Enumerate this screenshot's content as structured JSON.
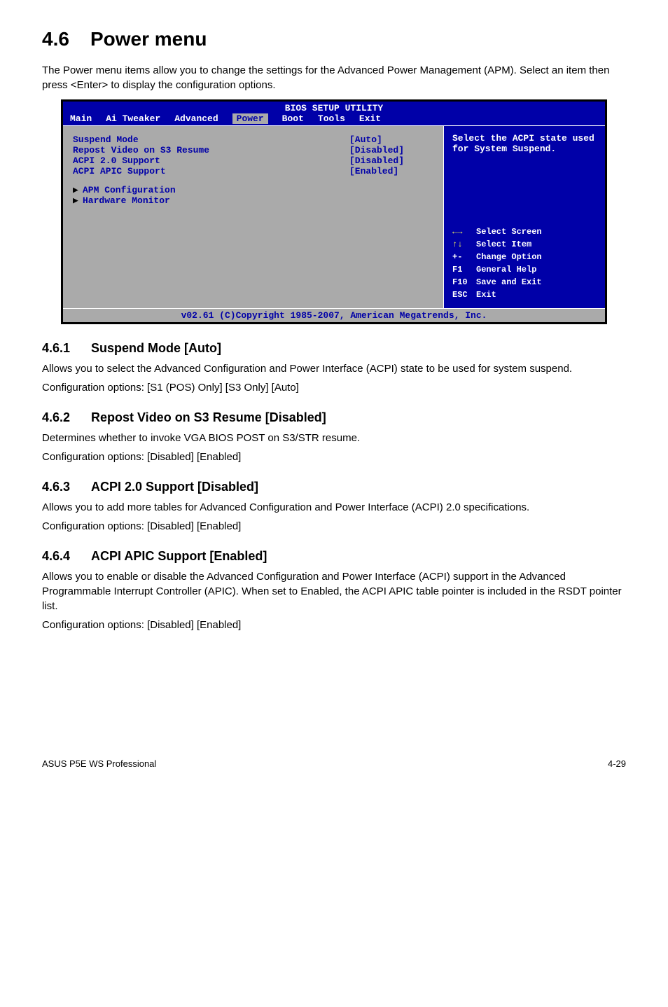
{
  "section": {
    "num": "4.6",
    "title": "Power menu"
  },
  "intro": "The Power menu items allow you to change the settings for the Advanced Power Management (APM). Select an item then press <Enter> to display the configuration options.",
  "bios": {
    "title": "BIOS SETUP UTILITY",
    "tabs": [
      "Main",
      "Ai Tweaker",
      "Advanced",
      "Power",
      "Boot",
      "Tools",
      "Exit"
    ],
    "activeTab": "Power",
    "rows": [
      {
        "label": "Suspend Mode",
        "value": "[Auto]"
      },
      {
        "label": "Repost Video on S3 Resume",
        "value": "[Disabled]"
      },
      {
        "label": "ACPI 2.0 Support",
        "value": "[Disabled]"
      },
      {
        "label": "ACPI APIC Support",
        "value": "[Enabled]"
      }
    ],
    "subs": [
      "APM Configuration",
      "Hardware Monitor"
    ],
    "helpTop": "Select the ACPI state used for System Suspend.",
    "helpKeys": [
      {
        "key": "←→",
        "desc": "Select Screen",
        "yel": true
      },
      {
        "key": "↑↓",
        "desc": "Select Item",
        "yel": true
      },
      {
        "key": "+-",
        "desc": "Change Option",
        "yel": false
      },
      {
        "key": "F1",
        "desc": "General Help",
        "yel": false
      },
      {
        "key": "F10",
        "desc": "Save and Exit",
        "yel": false
      },
      {
        "key": "ESC",
        "desc": "Exit",
        "yel": false
      }
    ],
    "footer": "v02.61 (C)Copyright 1985-2007, American Megatrends, Inc."
  },
  "subs": [
    {
      "num": "4.6.1",
      "title": "Suspend Mode [Auto]",
      "p1": "Allows you to select the Advanced Configuration and Power Interface (ACPI) state to be used for system suspend.",
      "p2": "Configuration options: [S1 (POS) Only] [S3 Only] [Auto]"
    },
    {
      "num": "4.6.2",
      "title": "Repost Video on S3 Resume [Disabled]",
      "p1": "Determines whether to invoke VGA BIOS POST on S3/STR resume.",
      "p2": "Configuration options: [Disabled] [Enabled]"
    },
    {
      "num": "4.6.3",
      "title": "ACPI 2.0 Support [Disabled]",
      "p1": "Allows you to add more tables for Advanced Configuration and Power Interface (ACPI) 2.0 specifications.",
      "p2": "Configuration options: [Disabled] [Enabled]"
    },
    {
      "num": "4.6.4",
      "title": "ACPI APIC Support [Enabled]",
      "p1": "Allows you to enable or disable the Advanced Configuration and Power Interface (ACPI) support in the Advanced Programmable Interrupt Controller (APIC). When set to Enabled, the ACPI APIC table pointer is included in the RSDT pointer list.",
      "p2": "Configuration options: [Disabled] [Enabled]"
    }
  ],
  "footer": {
    "left": "ASUS P5E WS Professional",
    "right": "4-29"
  }
}
